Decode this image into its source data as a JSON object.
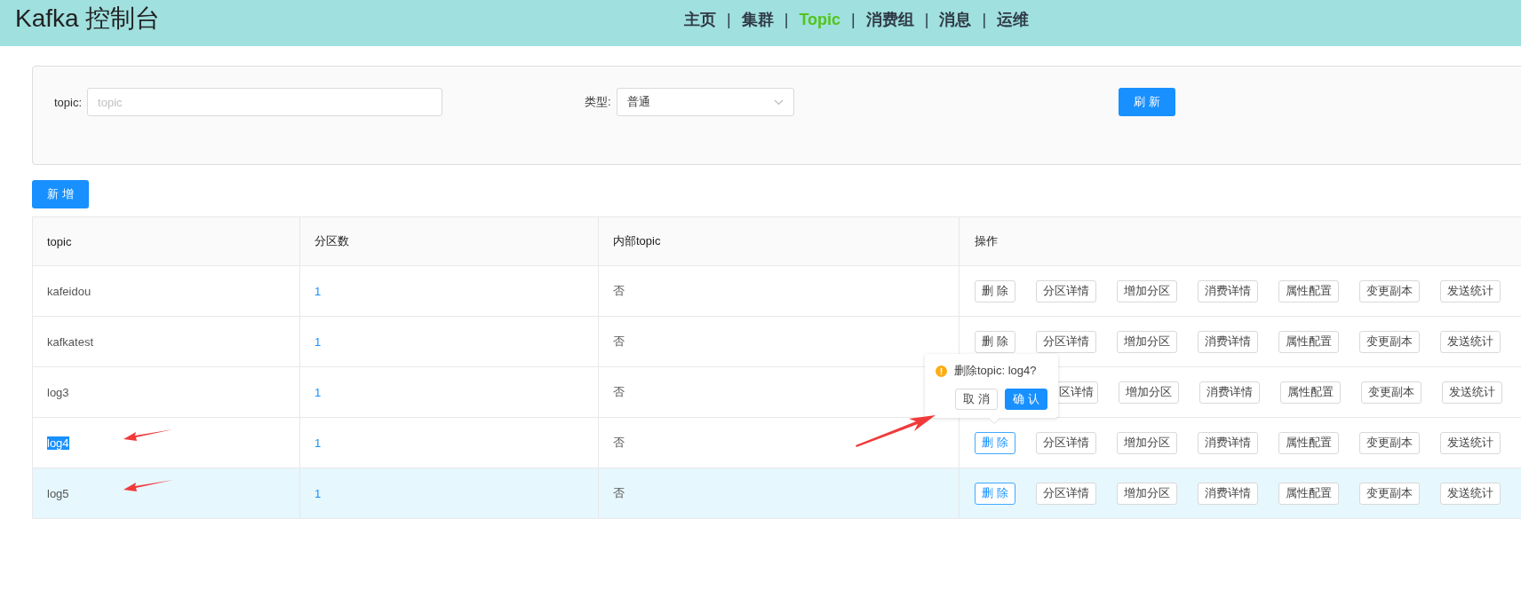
{
  "header": {
    "title": "Kafka 控制台",
    "nav": [
      {
        "label": "主页",
        "selected": false
      },
      {
        "label": "集群",
        "selected": false
      },
      {
        "label": "Topic",
        "selected": true
      },
      {
        "label": "消费组",
        "selected": false
      },
      {
        "label": "消息",
        "selected": false
      },
      {
        "label": "运维",
        "selected": false
      }
    ],
    "separator": "|"
  },
  "filter": {
    "topic_label": "topic:",
    "topic_placeholder": "topic",
    "type_label": "类型:",
    "type_value": "普通",
    "refresh_button": "刷 新"
  },
  "add_button": "新 增",
  "table": {
    "columns": [
      "topic",
      "分区数",
      "内部topic",
      "操作"
    ],
    "rows": [
      {
        "topic": "kafeidou",
        "partitions": "1",
        "internal": "否",
        "highlighted": false,
        "text_selected": false,
        "marked": false,
        "actions": [
          {
            "kind": "button",
            "label": "删 除",
            "active": false
          },
          {
            "kind": "button",
            "label": "分区详情",
            "active": false
          },
          {
            "kind": "button",
            "label": "增加分区",
            "active": false
          },
          {
            "kind": "button",
            "label": "消费详情",
            "active": false
          },
          {
            "kind": "button",
            "label": "属性配置",
            "active": false
          },
          {
            "kind": "button",
            "label": "变更副本",
            "active": false
          },
          {
            "kind": "button",
            "label": "发送统计",
            "active": false
          }
        ]
      },
      {
        "topic": "kafkatest",
        "partitions": "1",
        "internal": "否",
        "highlighted": false,
        "text_selected": false,
        "marked": false,
        "actions": [
          {
            "kind": "button",
            "label": "删 除",
            "active": false
          },
          {
            "kind": "button",
            "label": "分区详情",
            "active": false
          },
          {
            "kind": "button",
            "label": "增加分区",
            "active": false
          },
          {
            "kind": "button",
            "label": "消费详情",
            "active": false
          },
          {
            "kind": "button",
            "label": "属性配置",
            "active": false
          },
          {
            "kind": "button",
            "label": "变更副本",
            "active": false
          },
          {
            "kind": "button",
            "label": "发送统计",
            "active": false
          }
        ]
      },
      {
        "topic": "log3",
        "partitions": "1",
        "internal": "否",
        "highlighted": false,
        "text_selected": false,
        "marked": false,
        "actions": [
          {
            "kind": "covered"
          },
          {
            "kind": "partial",
            "label": "区详情",
            "active": false
          },
          {
            "kind": "button",
            "label": "增加分区",
            "active": false
          },
          {
            "kind": "button",
            "label": "消费详情",
            "active": false
          },
          {
            "kind": "button",
            "label": "属性配置",
            "active": false
          },
          {
            "kind": "button",
            "label": "变更副本",
            "active": false
          },
          {
            "kind": "button",
            "label": "发送统计",
            "active": false
          }
        ]
      },
      {
        "topic": "log4",
        "partitions": "1",
        "internal": "否",
        "highlighted": false,
        "text_selected": true,
        "marked": true,
        "actions": [
          {
            "kind": "button",
            "label": "删 除",
            "active": true
          },
          {
            "kind": "button",
            "label": "分区详情",
            "active": false
          },
          {
            "kind": "button",
            "label": "增加分区",
            "active": false
          },
          {
            "kind": "button",
            "label": "消费详情",
            "active": false
          },
          {
            "kind": "button",
            "label": "属性配置",
            "active": false
          },
          {
            "kind": "button",
            "label": "变更副本",
            "active": false
          },
          {
            "kind": "button",
            "label": "发送统计",
            "active": false
          }
        ]
      },
      {
        "topic": "log5",
        "partitions": "1",
        "internal": "否",
        "highlighted": true,
        "text_selected": false,
        "marked": true,
        "actions": [
          {
            "kind": "button",
            "label": "删 除",
            "active": true
          },
          {
            "kind": "button",
            "label": "分区详情",
            "active": false
          },
          {
            "kind": "button",
            "label": "增加分区",
            "active": false
          },
          {
            "kind": "button",
            "label": "消费详情",
            "active": false
          },
          {
            "kind": "button",
            "label": "属性配置",
            "active": false
          },
          {
            "kind": "button",
            "label": "变更副本",
            "active": false
          },
          {
            "kind": "button",
            "label": "发送统计",
            "active": false
          }
        ]
      }
    ]
  },
  "popconfirm": {
    "open": true,
    "message": "删除topic: log4?",
    "cancel": "取 消",
    "confirm": "确 认",
    "marked": true
  }
}
